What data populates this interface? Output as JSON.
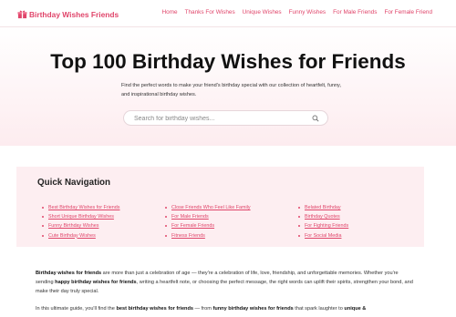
{
  "brand": {
    "name": "Birthday Wishes Friends",
    "accent": "#e0456a"
  },
  "nav": [
    {
      "label": "Home"
    },
    {
      "label": "Thanks For Wishes"
    },
    {
      "label": "Unique Wishes"
    },
    {
      "label": "Funny Wishes"
    },
    {
      "label": "For Male Friends"
    },
    {
      "label": "For Female Friend"
    }
  ],
  "hero": {
    "title": "Top 100 Birthday Wishes for Friends",
    "subtitle": "Find the perfect words to make your friend's birthday special with our collection of heartfelt, funny, and inspirational birthday wishes.",
    "search_placeholder": "Search for birthday wishes..."
  },
  "quick_nav": {
    "title": "Quick Navigation",
    "col1": [
      "Best Birthday Wishes for Friends",
      "Short Unique Birthday Wishes",
      "Funny Birthday Wishes",
      "Cute Birthday Wishes"
    ],
    "col2": [
      "Close Friends Who Feel Like Family",
      "For Male Friends",
      "For Female Friends",
      "Fitness Friends"
    ],
    "col3": [
      "Belated Birthday",
      "Birthday Quotes",
      "For Fighting Friends",
      "For Social Media"
    ]
  },
  "article": {
    "p1_bold": "Birthday wishes for friends",
    "p1_a": " are more than just a celebration of age — they're a celebration of life, love, friendship, and unforgettable memories. Whether you're sending ",
    "p1_bold2": "happy birthday wishes for friends",
    "p1_b": ", writing a heartfelt note, or choosing the perfect message, the right words can uplift their spirits, strengthen your bond, and make their day truly special.",
    "p2_a": "In this ultimate guide, you'll find the ",
    "p2_bold": "best birthday wishes for friends",
    "p2_b": " — from ",
    "p2_bold2": "funny birthday wishes for friends",
    "p2_c": " that spark laughter to ",
    "p2_bold3": "unique &"
  }
}
